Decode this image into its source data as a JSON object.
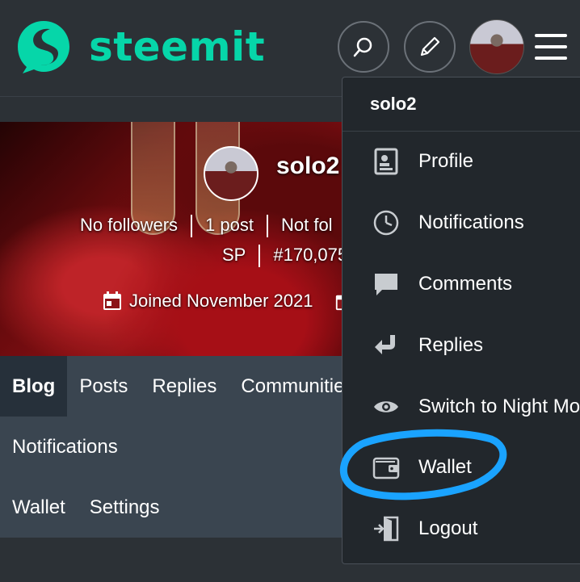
{
  "header": {
    "logo_text": "steemit"
  },
  "profile": {
    "name": "solo2",
    "followers": "No followers",
    "posts": "1 post",
    "following": "Not fol",
    "sp": "SP",
    "rank": "#170,075",
    "joined": "Joined November 2021"
  },
  "tabs": {
    "row1": [
      "Blog",
      "Posts",
      "Replies",
      "Communitie"
    ],
    "row2": [
      "Notifications"
    ],
    "row3": [
      "Wallet",
      "Settings"
    ]
  },
  "menu": {
    "username": "solo2",
    "items": [
      {
        "label": "Profile",
        "icon": "profile-icon"
      },
      {
        "label": "Notifications",
        "icon": "clock-icon"
      },
      {
        "label": "Comments",
        "icon": "comment-icon"
      },
      {
        "label": "Replies",
        "icon": "reply-icon"
      },
      {
        "label": "Switch to Night Mo",
        "icon": "eye-icon"
      },
      {
        "label": "Wallet",
        "icon": "wallet-icon"
      },
      {
        "label": "Logout",
        "icon": "logout-icon"
      }
    ]
  },
  "colors": {
    "brand": "#06d6a9",
    "header_bg": "#2c3136",
    "menu_bg": "#22272c",
    "annotation": "#1aa3ff"
  }
}
